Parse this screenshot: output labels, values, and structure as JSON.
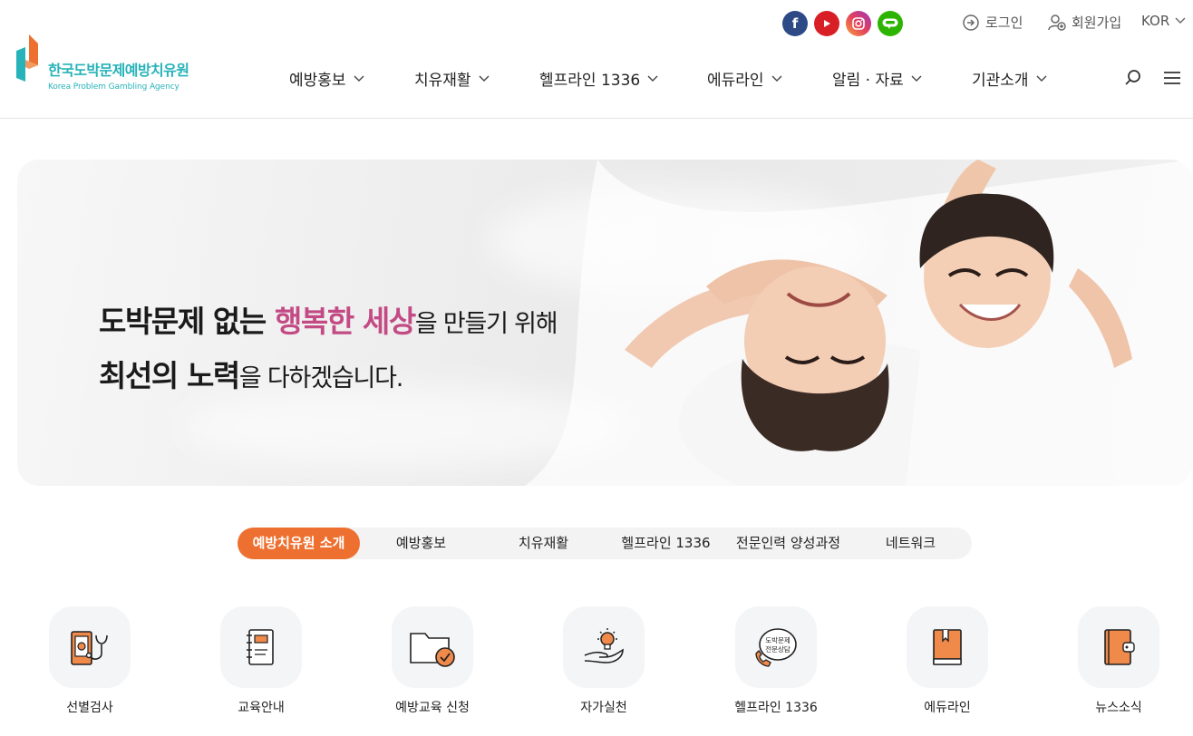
{
  "header": {
    "logo_ko": "한국도박문제예방치유원",
    "logo_en": "Korea Problem Gambling Agency",
    "login": "로그인",
    "join": "회원가입",
    "lang": "KOR",
    "social": [
      "facebook-icon",
      "youtube-icon",
      "instagram-icon",
      "blog-icon"
    ]
  },
  "gnb": [
    "예방홍보",
    "치유재활",
    "헬프라인 1336",
    "에듀라인",
    "알림 · 자료",
    "기관소개"
  ],
  "hero": {
    "l1a": "도박문제 없는 ",
    "l1b": "행복한 세상",
    "l1c": "을 만들기 위해",
    "l2a": "최선의 노력",
    "l2b": "을 다하겠습니다."
  },
  "tabs": [
    "예방치유원 소개",
    "예방홍보",
    "치유재활",
    "헬프라인 1336",
    "전문인력 양성과정",
    "네트워크"
  ],
  "quick": [
    "선별검사",
    "교육안내",
    "예방교육 신청",
    "자가실천",
    "헬프라인 1336",
    "에듀라인",
    "뉴스소식"
  ],
  "badge": {
    "l1": "도박문제",
    "l2": "전문상담"
  },
  "colors": {
    "accent": "#ee7030",
    "brand": "#27b3b9",
    "highlight": "#c34a84"
  }
}
